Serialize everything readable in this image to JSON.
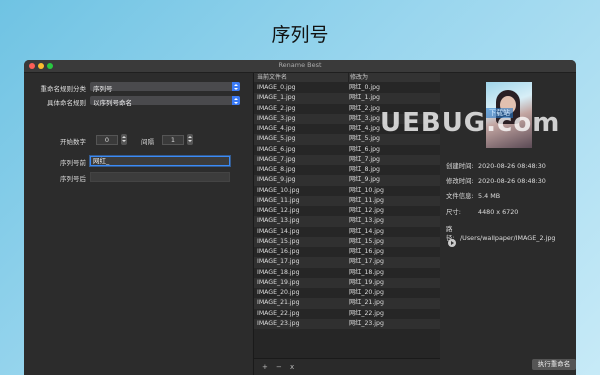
{
  "page": {
    "title": "序列号"
  },
  "window": {
    "title": "Rename Best"
  },
  "settings": {
    "rule_category_label": "重命名规则分类",
    "rule_category_value": "序列号",
    "rule_label": "具体命名规则",
    "rule_value": "以序列号命名",
    "start_label": "开始数字",
    "start_value": "0",
    "interval_label": "间隔",
    "interval_value": "1",
    "prefix_label": "序列号前",
    "prefix_value": "网红_",
    "suffix_label": "序列号后",
    "suffix_value": ""
  },
  "list": {
    "header_current": "当前文件名",
    "header_new": "修改为",
    "rows": [
      {
        "current": "IMAGE_0.jpg",
        "new": "网红_0.jpg"
      },
      {
        "current": "IMAGE_1.jpg",
        "new": "网红_1.jpg"
      },
      {
        "current": "IMAGE_2.jpg",
        "new": "网红_2.jpg"
      },
      {
        "current": "IMAGE_3.jpg",
        "new": "网红_3.jpg"
      },
      {
        "current": "IMAGE_4.jpg",
        "new": "网红_4.jpg"
      },
      {
        "current": "IMAGE_5.jpg",
        "new": "网红_5.jpg"
      },
      {
        "current": "IMAGE_6.jpg",
        "new": "网红_6.jpg"
      },
      {
        "current": "IMAGE_7.jpg",
        "new": "网红_7.jpg"
      },
      {
        "current": "IMAGE_8.jpg",
        "new": "网红_8.jpg"
      },
      {
        "current": "IMAGE_9.jpg",
        "new": "网红_9.jpg"
      },
      {
        "current": "IMAGE_10.jpg",
        "new": "网红_10.jpg"
      },
      {
        "current": "IMAGE_11.jpg",
        "new": "网红_11.jpg"
      },
      {
        "current": "IMAGE_12.jpg",
        "new": "网红_12.jpg"
      },
      {
        "current": "IMAGE_13.jpg",
        "new": "网红_13.jpg"
      },
      {
        "current": "IMAGE_14.jpg",
        "new": "网红_14.jpg"
      },
      {
        "current": "IMAGE_15.jpg",
        "new": "网红_15.jpg"
      },
      {
        "current": "IMAGE_16.jpg",
        "new": "网红_16.jpg"
      },
      {
        "current": "IMAGE_17.jpg",
        "new": "网红_17.jpg"
      },
      {
        "current": "IMAGE_18.jpg",
        "new": "网红_18.jpg"
      },
      {
        "current": "IMAGE_19.jpg",
        "new": "网红_19.jpg"
      },
      {
        "current": "IMAGE_20.jpg",
        "new": "网红_20.jpg"
      },
      {
        "current": "IMAGE_21.jpg",
        "new": "网红_21.jpg"
      },
      {
        "current": "IMAGE_22.jpg",
        "new": "网红_22.jpg"
      },
      {
        "current": "IMAGE_23.jpg",
        "new": "网红_23.jpg"
      }
    ],
    "add_label": "+",
    "remove_label": "−",
    "clear_label": "x"
  },
  "info": {
    "created_label": "创建时间:",
    "created_value": "2020-08-26 08:48:30",
    "modified_label": "修改时间:",
    "modified_value": "2020-08-26 08:48:30",
    "size_label": "文件信息:",
    "size_value": "5.4 MB",
    "dimension_label": "尺寸:",
    "dimension_value": "4480 x 6720",
    "path_label": "路径:",
    "path_value": "/Users/wallpaper/IMAGE_2.jpg"
  },
  "actions": {
    "execute_label": "执行重命名"
  },
  "watermark": {
    "text": "UEBUG.com",
    "sub": "下载站"
  }
}
